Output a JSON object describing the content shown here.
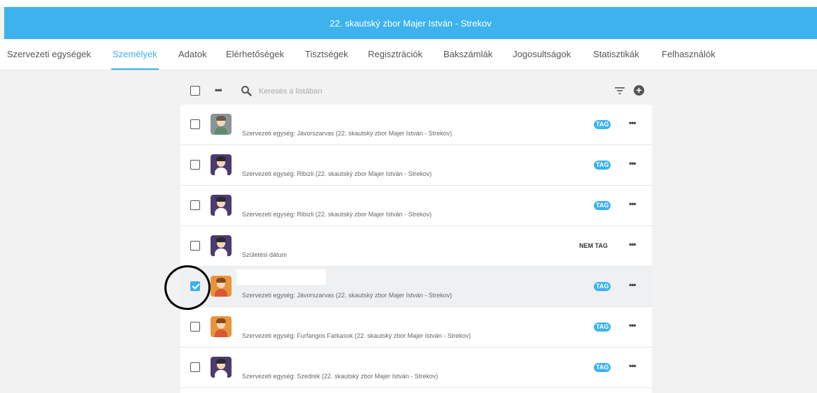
{
  "header": {
    "title": "22. skautský zbor Majer István - Strekov"
  },
  "tabs": [
    {
      "label": "Szervezeti egységek"
    },
    {
      "label": "Személyek"
    },
    {
      "label": "Adatok"
    },
    {
      "label": "Elérhetőségek"
    },
    {
      "label": "Tisztségek"
    },
    {
      "label": "Regisztrációk"
    },
    {
      "label": "Bakszámlák"
    },
    {
      "label": "Jogosultságok"
    },
    {
      "label": "Statisztikák"
    },
    {
      "label": "Felhasználók"
    }
  ],
  "active_tab": "Személyek",
  "toolbar": {
    "more_label": "•••",
    "search_placeholder": "Keresés a listában",
    "add_label": "+"
  },
  "icons": {
    "search": "search-icon",
    "filter": "filter-icon",
    "add": "plus-circle-icon",
    "more": "ellipsis-icon"
  },
  "colors": {
    "accent": "#3db2ec",
    "header_bg": "#3db2ec",
    "selected_row_bg": "#eef0f2"
  },
  "rows": [
    {
      "unit": "Szervezeti egység: Jávorszarvas (22. skautský zbor Majer István - Strekov)",
      "badge": "TAG",
      "checked": false
    },
    {
      "unit": "Szervezeti egység: Ribizli (22. skautský zbor Majer István - Strekov)",
      "badge": "TAG",
      "checked": false
    },
    {
      "unit": "Szervezeti egység: Ribizli (22. skautský zbor Majer István - Strekov)",
      "badge": "TAG",
      "checked": false
    },
    {
      "unit": "Születési dátum",
      "badge": "NEM TAG",
      "checked": false
    },
    {
      "unit": "Szervezeti egység: Jávorszarvas (22. skautský zbor Majer István - Strekov)",
      "badge": "TAG",
      "checked": true
    },
    {
      "unit": "Szervezeti egység: Furfangos Farkasok (22. skautský zbor Majer István - Strekov)",
      "badge": "TAG",
      "checked": false
    },
    {
      "unit": "Szervezeti egység: Szedrek (22. skautský zbor Majer István - Strekov)",
      "badge": "TAG",
      "checked": false
    }
  ],
  "row_more_label": "•••"
}
